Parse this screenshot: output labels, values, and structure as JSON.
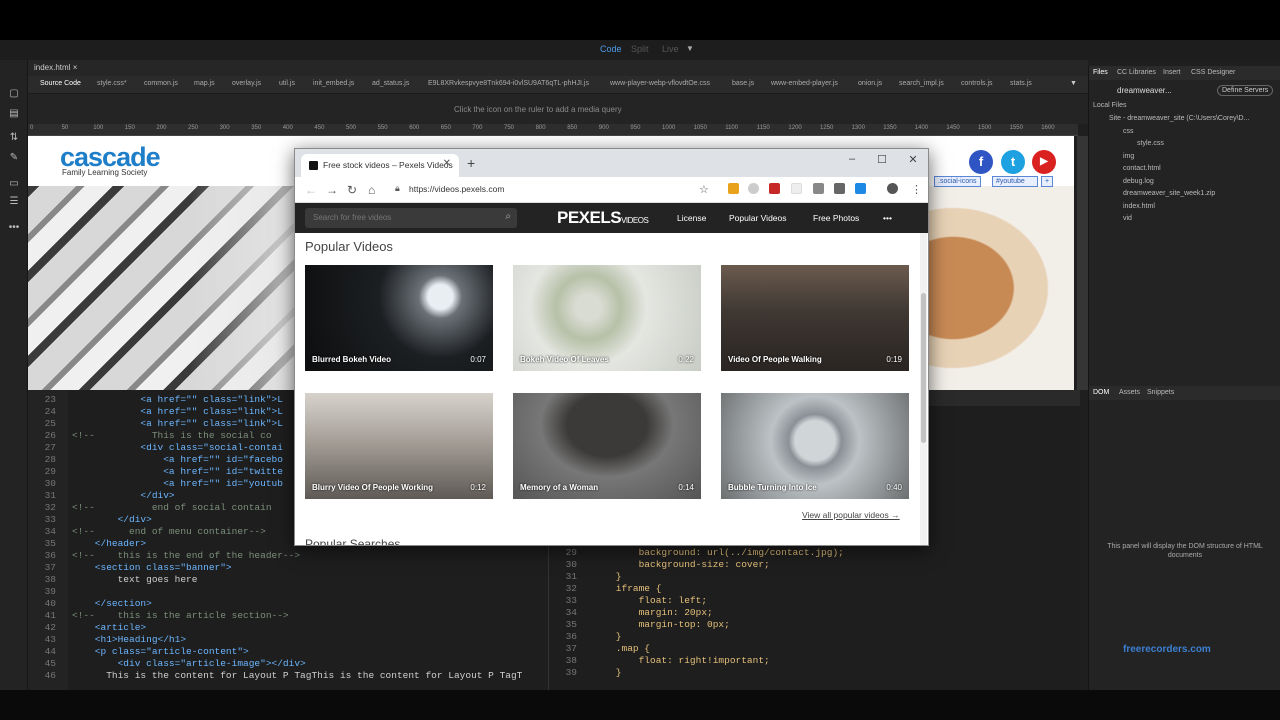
{
  "dw": {
    "view_modes": {
      "code": "Code",
      "split": "Split",
      "live": "Live"
    },
    "doc_tab": "index.html",
    "related_files": [
      "Source Code",
      "style.css*",
      "common.js",
      "map.js",
      "overlay.js",
      "util.js",
      "init_embed.js",
      "ad_status.js",
      "E9L8XRvkespvye8Tnk694-i0vlSU9AT6qTL-phHJI.js",
      "www-player-webp-vflovdtOe.css",
      "base.js",
      "www-embed-player.js",
      "onion.js",
      "search_impl.js",
      "controls.js",
      "stats.js"
    ],
    "media_query_hint": "Click the  icon on the ruler to add a media query",
    "ruler_ticks": [
      "0",
      "50",
      "100",
      "150",
      "200",
      "250",
      "300",
      "350",
      "400",
      "450",
      "500",
      "550",
      "600",
      "650",
      "700",
      "750",
      "800",
      "850",
      "900",
      "950",
      "1000",
      "1050",
      "1100",
      "1150",
      "1200",
      "1250",
      "1300",
      "1350",
      "1400",
      "1450",
      "1500",
      "1550",
      "1600"
    ],
    "live": {
      "brand": "cascade",
      "brand_sub": "Family Learning Society",
      "social": [
        "f",
        "t",
        "▶"
      ],
      "tag_chips": [
        ".social-icons",
        "#youtube",
        "+"
      ]
    },
    "code_left": [
      {
        "n": "23",
        "t": "            <a href=\"\" class=\"link\">L"
      },
      {
        "n": "24",
        "t": "            <a href=\"\" class=\"link\">L"
      },
      {
        "n": "25",
        "t": "            <a href=\"\" class=\"link\">L"
      },
      {
        "n": "26",
        "t": "<!--          This is the social co"
      },
      {
        "n": "27",
        "t": "            <div class=\"social-contai"
      },
      {
        "n": "28",
        "t": "                <a href=\"\" id=\"facebo"
      },
      {
        "n": "29",
        "t": "                <a href=\"\" id=\"twitte"
      },
      {
        "n": "30",
        "t": "                <a href=\"\" id=\"youtub"
      },
      {
        "n": "31",
        "t": "            </div>"
      },
      {
        "n": "32",
        "t": "<!--          end of social contain"
      },
      {
        "n": "33",
        "t": "        </div>"
      },
      {
        "n": "34",
        "t": "<!--      end of menu container-->"
      },
      {
        "n": "35",
        "t": "    </header>"
      },
      {
        "n": "36",
        "t": "<!--    this is the end of the header-->"
      },
      {
        "n": "37",
        "t": "    <section class=\"banner\">"
      },
      {
        "n": "38",
        "t": "        text goes here"
      },
      {
        "n": "39",
        "t": ""
      },
      {
        "n": "40",
        "t": "    </section>"
      },
      {
        "n": "41",
        "t": "<!--    this is the article section-->"
      },
      {
        "n": "42",
        "t": "    <article>"
      },
      {
        "n": "43",
        "t": "    <h1>Heading</h1>"
      },
      {
        "n": "44",
        "t": "    <p class=\"article-content\">"
      },
      {
        "n": "45",
        "t": "        <div class=\"article-image\"></div>"
      },
      {
        "n": "46",
        "t": "      This is the content for Layout P TagThis is the content for Layout P TagT"
      }
    ],
    "code_right": [
      {
        "n": "29",
        "t": "        background: url(../img/contact.jpg);"
      },
      {
        "n": "30",
        "t": "        background-size: cover;"
      },
      {
        "n": "31",
        "t": "    }"
      },
      {
        "n": "32",
        "t": "    iframe {"
      },
      {
        "n": "33",
        "t": "        float: left;"
      },
      {
        "n": "34",
        "t": "        margin: 20px;"
      },
      {
        "n": "35",
        "t": "        margin-top: 0px;"
      },
      {
        "n": "36",
        "t": "    }"
      },
      {
        "n": "37",
        "t": "    .map {"
      },
      {
        "n": "38",
        "t": "        float: right!important;"
      },
      {
        "n": "39",
        "t": "    }"
      }
    ],
    "right_tabs": [
      "Files",
      "CC Libraries",
      "Insert",
      "CSS Designer"
    ],
    "files_site": "dreamweaver...",
    "define_servers": "Define Servers",
    "local_files_label": "Local Files",
    "file_tree": [
      {
        "t": "Site - dreamweaver_site (C:\\Users\\Corey\\D...",
        "d": 0
      },
      {
        "t": "css",
        "d": 1
      },
      {
        "t": "style.css",
        "d": 2
      },
      {
        "t": "img",
        "d": 1
      },
      {
        "t": "contact.html",
        "d": 1
      },
      {
        "t": "debug.log",
        "d": 1
      },
      {
        "t": "dreamweaver_site_week1.zip",
        "d": 1
      },
      {
        "t": "index.html",
        "d": 1
      },
      {
        "t": "vid",
        "d": 1
      }
    ],
    "dom_tabs": [
      "DOM",
      "Assets",
      "Snippets"
    ],
    "dom_message": "This panel will display the DOM structure of HTML documents",
    "watermark": "freerecorders.com"
  },
  "browser": {
    "tab_title": "Free stock videos – Pexels Videos",
    "url": "https://videos.pexels.com",
    "search_placeholder": "Search for free videos",
    "logo": "PEXELS",
    "logo_suffix": "VIDEOS",
    "nav": [
      "License",
      "Popular Videos",
      "Free Photos",
      "•••"
    ],
    "section_title": "Popular Videos",
    "videos": [
      {
        "title": "Blurred Bokeh Video",
        "duration": "0:07"
      },
      {
        "title": "Bokeh Video Of Leaves",
        "duration": "0:22"
      },
      {
        "title": "Video Of People Walking",
        "duration": "0:19"
      },
      {
        "title": "Blurry Video Of People Working",
        "duration": "0:12"
      },
      {
        "title": "Memory of a Woman",
        "duration": "0:14"
      },
      {
        "title": "Bubble Turning Into Ice",
        "duration": "0:40"
      }
    ],
    "view_all": "View all popular videos →",
    "popular_searches": "Popular Searches"
  }
}
